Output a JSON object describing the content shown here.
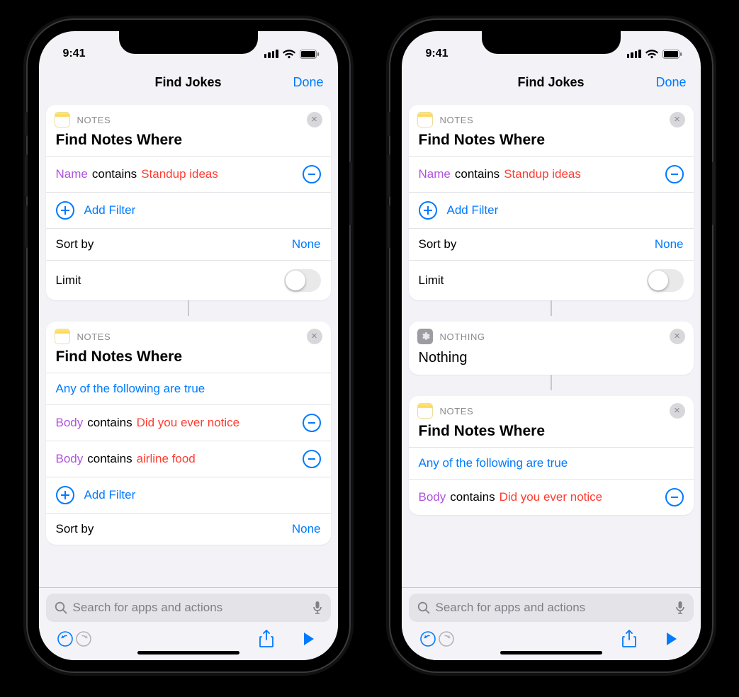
{
  "status": {
    "time": "9:41"
  },
  "nav": {
    "title": "Find Jokes",
    "done": "Done"
  },
  "labels": {
    "notes_app": "NOTES",
    "nothing_app": "NOTHING",
    "find_notes_where": "Find Notes Where",
    "nothing": "Nothing",
    "add_filter": "Add Filter",
    "sort_by": "Sort by",
    "none": "None",
    "limit": "Limit",
    "contains": "contains",
    "any_true": "Any of the following are true"
  },
  "fields": {
    "name": "Name",
    "body": "Body"
  },
  "values": {
    "standup_ideas": "Standup ideas",
    "did_you_ever_notice": "Did you ever notice",
    "airline_food": "airline food"
  },
  "search": {
    "placeholder": "Search for apps and actions"
  }
}
